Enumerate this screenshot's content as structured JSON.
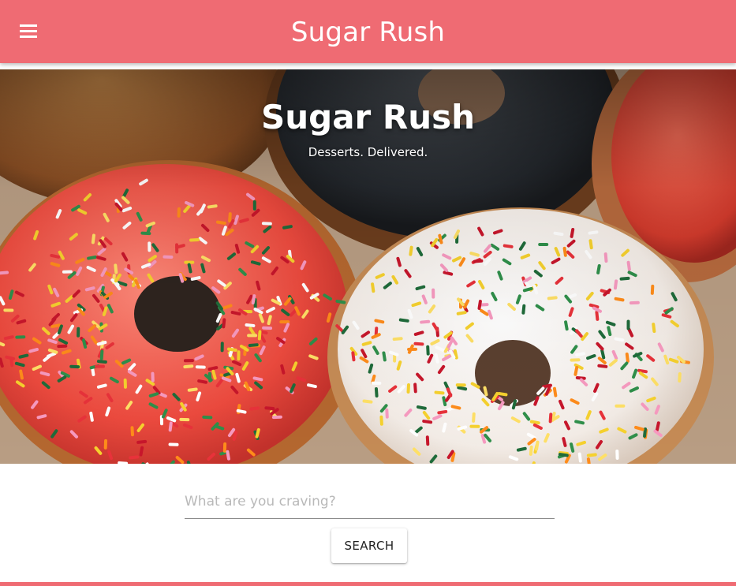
{
  "app_bar": {
    "title": "Sugar Rush",
    "menu_icon": "hamburger-menu-icon",
    "background_color": "#ef6b73"
  },
  "hero": {
    "title": "Sugar Rush",
    "subtitle": "Desserts. Delivered."
  },
  "search": {
    "placeholder": "What are you craving?",
    "value": "",
    "button_label": "SEARCH"
  },
  "colors": {
    "accent": "#ef6b73",
    "text_light": "#ffffff"
  }
}
